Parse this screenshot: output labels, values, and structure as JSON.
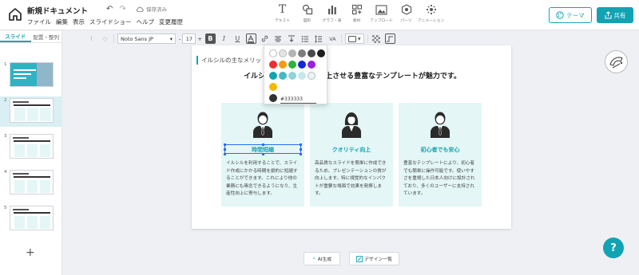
{
  "header": {
    "doc_title": "新規ドキュメント",
    "menu": [
      "ファイル",
      "編集",
      "表示",
      "スライドショー",
      "ヘルプ",
      "変更履歴"
    ],
    "undo_icon": "undo-icon",
    "redo_icon": "redo-icon",
    "saved_label": "保存済み",
    "tools": [
      {
        "label": "テキスト",
        "glyph": "T"
      },
      {
        "label": "図形",
        "glyph": "◔"
      },
      {
        "label": "グラフ・表",
        "glyph": "▮"
      },
      {
        "label": "素材",
        "glyph": "⧉"
      },
      {
        "label": "アップロード",
        "glyph": "▭"
      },
      {
        "label": "パーツ",
        "glyph": "◈"
      },
      {
        "label": "アニメーション",
        "glyph": "✳"
      }
    ],
    "theme_label": "テーマ",
    "share_label": "共有"
  },
  "sidebar": {
    "tabs": [
      "スライド",
      "配置・整列"
    ],
    "slides": [
      "1",
      "2",
      "3",
      "4",
      "5"
    ],
    "add_label": "+"
  },
  "format": {
    "font": "Noto Sans JP",
    "size": "17",
    "size_minus": "-",
    "size_plus": "+"
  },
  "palette": {
    "colors": [
      "#ffffff",
      "#e5e5e5",
      "#b5b5b5",
      "#7d7d7d",
      "#4a4a4a",
      "#1e1e1e",
      "#e8302f",
      "#f39c12",
      "#2eb33a",
      "#1428d6",
      "#9b1fe0",
      "#12a3b3",
      "#47b8c4",
      "#90d3da",
      "#c5e8ec",
      "#e7f5f7",
      "#f5b800",
      "#333333"
    ],
    "hex": "#333333"
  },
  "slide": {
    "subheading": "イルシルの主なメリッ",
    "headline": "イルシルは                 化し、質を向上させる豊富なテンプレートが魅力です。",
    "cards": [
      {
        "title": "時間短縮",
        "body": "イルシルを利用することで、スライド作成にかかる時間を劇的に短縮することができます。これにより他の業務にも専念できるようになり、生産性向上に寄与します。"
      },
      {
        "title": "クオリティ向上",
        "body": "高品質なスライドを簡単に作成できるため、プレゼンテーションの質が向上します。特に視覚的なインパクトが重要な場面で効果を発揮します。"
      },
      {
        "title": "初心者でも安心",
        "body": "豊富なテンプレートにより、初心者でも簡単に操作可能です。使いやすさを重視した日本人向けに設計されており、多くのユーザーに支持されています。"
      }
    ]
  },
  "bottom": {
    "ai_label": "AI生成",
    "design_label": "デザイン一覧"
  },
  "help_label": "?",
  "colors": {
    "accent": "#12a3b3",
    "card_bg": "#e4f6f6",
    "selection": "#2a6df4"
  }
}
